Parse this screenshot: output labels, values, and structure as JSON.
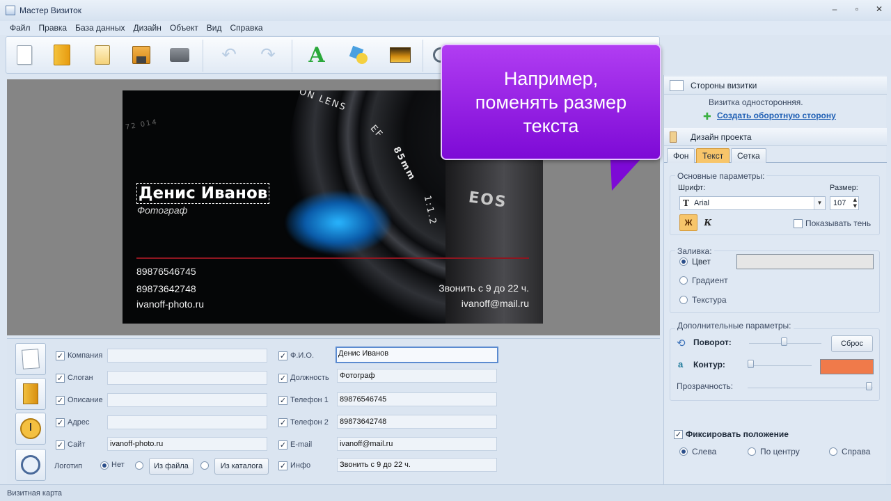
{
  "window": {
    "title": "Мастер Визиток",
    "minimize": "–",
    "maximize": "▫",
    "close": "✕"
  },
  "menu": [
    "Файл",
    "Правка",
    "База данных",
    "Дизайн",
    "Объект",
    "Вид",
    "Справка"
  ],
  "toolbar": {
    "icons": [
      "new-page-icon",
      "open-folder-icon",
      "paste-icon",
      "save-icon",
      "print-icon",
      "undo-icon",
      "redo-icon",
      "add-text-icon",
      "add-shape-icon",
      "add-image-icon",
      "zoom-icon"
    ],
    "text_glyph": "A",
    "undo_glyph": "↶",
    "redo_glyph": "↷"
  },
  "card": {
    "name": "Денис Иванов",
    "job": "Фотограф",
    "phone1": "89876546745",
    "phone2": "89873642748",
    "site": "ivanoff-photo.ru",
    "hours": "Звонить с 9 до 22 ч.",
    "email": "ivanoff@mail.ru",
    "lens_text1": "ON LENS",
    "lens_text2": "EF",
    "lens_text3": "85mm",
    "lens_text4": "1:1.2",
    "lens_text5": "EOS",
    "lens_text6": "72 014"
  },
  "callout": {
    "text": "Например,\nпоменять размер\nтекста"
  },
  "form": {
    "left_fields": [
      {
        "label": "Компания",
        "value": ""
      },
      {
        "label": "Слоган",
        "value": ""
      },
      {
        "label": "Описание",
        "value": ""
      },
      {
        "label": "Адрес",
        "value": ""
      },
      {
        "label": "Сайт",
        "value": "ivanoff-photo.ru"
      }
    ],
    "right_fields": [
      {
        "label": "Ф.И.О.",
        "value": "Денис Иванов"
      },
      {
        "label": "Должность",
        "value": "Фотограф"
      },
      {
        "label": "Телефон 1",
        "value": "89876546745"
      },
      {
        "label": "Телефон 2",
        "value": "89873642748"
      },
      {
        "label": "E-mail",
        "value": "ivanoff@mail.ru"
      },
      {
        "label": "Инфо",
        "value": "Звонить с 9 до 22 ч."
      }
    ],
    "logo_label": "Логотип",
    "logo_none": "Нет",
    "logo_file": "Из файла",
    "logo_catalog": "Из каталога",
    "check": "✓"
  },
  "panel": {
    "sides_title": "Стороны визитки",
    "sides_info": "Визитка односторонняя.",
    "create_back": "Создать оборотную сторону",
    "plus": "✚",
    "design_title": "Дизайн проекта",
    "tabs": [
      "Фон",
      "Текст",
      "Сетка"
    ],
    "basic_params": "Основные параметры:",
    "font_label": "Шрифт:",
    "font_value": "Arial",
    "size_label": "Размер:",
    "size_value": "107",
    "bold": "Ж",
    "italic": "К",
    "shadow": "Показывать тень",
    "fill_label": "Заливка:",
    "fill_color": "Цвет",
    "fill_gradient": "Градиент",
    "fill_texture": "Текстура",
    "fill_swatch": "#e6e6e6",
    "extra_params": "Дополнительные параметры:",
    "rotate": "Поворот:",
    "reset": "Сброс",
    "outline": "Контур:",
    "outline_swatch": "#f07a4a",
    "opacity": "Прозрачность:",
    "fix_position": "Фиксировать положение",
    "align_left": "Слева",
    "align_center": "По центру",
    "align_right": "Справа"
  },
  "status": {
    "text": "Визитная карта"
  }
}
